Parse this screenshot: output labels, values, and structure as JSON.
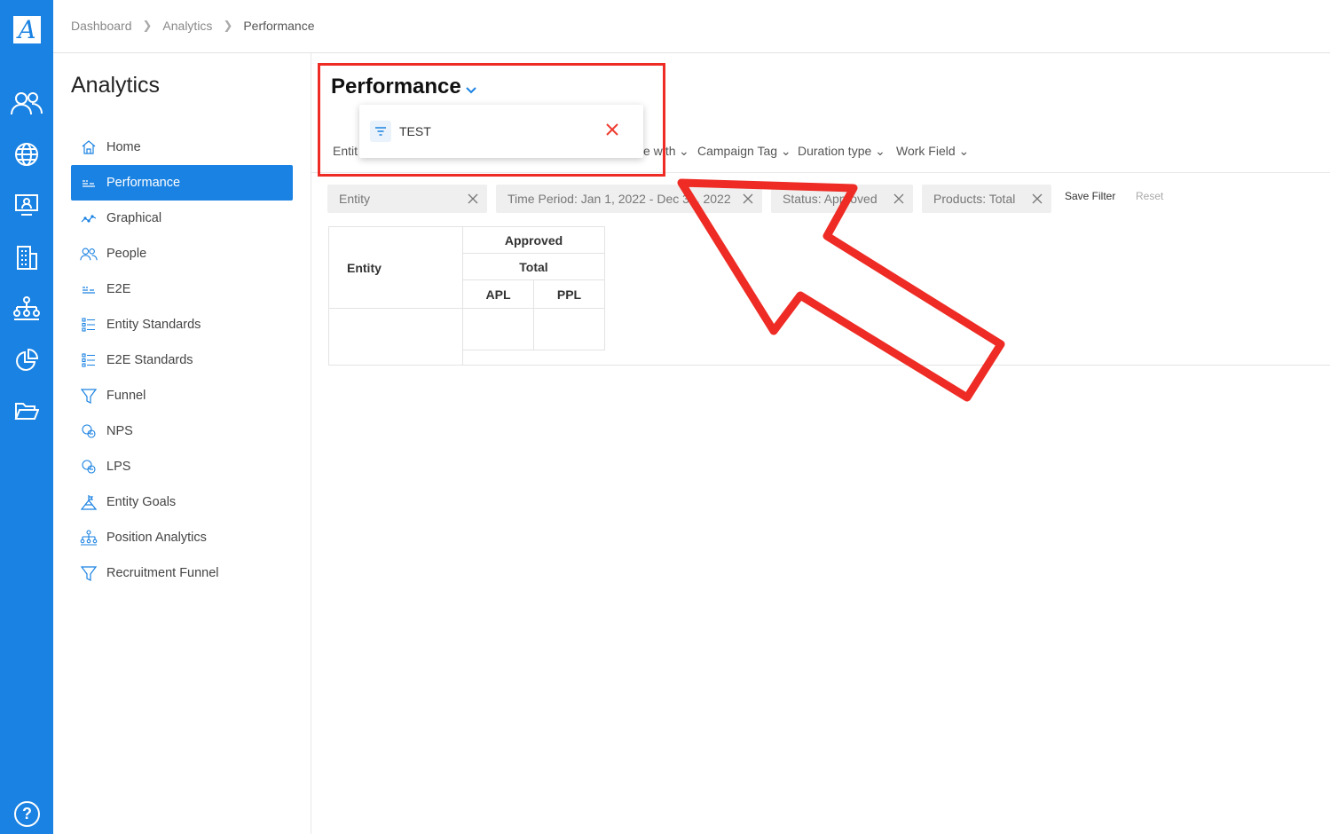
{
  "rail": {
    "logo": "A",
    "icons": [
      "people-icon",
      "globe-icon",
      "monitor-user-icon",
      "building-icon",
      "org-chart-icon",
      "pie-chart-icon",
      "folder-open-icon"
    ],
    "help": "?"
  },
  "breadcrumb": [
    "Dashboard",
    "Analytics",
    "Performance"
  ],
  "sidebar": {
    "title": "Analytics",
    "items": [
      {
        "label": "Home",
        "icon": "home-icon"
      },
      {
        "label": "Performance",
        "icon": "bars-icon",
        "active": true
      },
      {
        "label": "Graphical",
        "icon": "line-graph-icon"
      },
      {
        "label": "People",
        "icon": "people-icon"
      },
      {
        "label": "E2E",
        "icon": "bars-icon"
      },
      {
        "label": "Entity Standards",
        "icon": "list-icon"
      },
      {
        "label": "E2E Standards",
        "icon": "list-icon"
      },
      {
        "label": "Funnel",
        "icon": "funnel-icon"
      },
      {
        "label": "NPS",
        "icon": "nps-icon"
      },
      {
        "label": "LPS",
        "icon": "lps-icon"
      },
      {
        "label": "Entity Goals",
        "icon": "goal-icon"
      },
      {
        "label": "Position Analytics",
        "icon": "org-chart-icon"
      },
      {
        "label": "Recruitment Funnel",
        "icon": "funnel-icon"
      }
    ]
  },
  "main": {
    "title": "Performance",
    "saved_filter": {
      "label": "TEST"
    },
    "filter_bar": {
      "partial_left": "Entit",
      "partial_mid": "e with",
      "items": [
        "Campaign Tag",
        "Duration type",
        "Work Field"
      ]
    },
    "chips": [
      {
        "label": "Entity"
      },
      {
        "label": "Time Period: Jan 1, 2022 - Dec 31, 2022"
      },
      {
        "label": "Status: Approved"
      },
      {
        "label": "Products: Total"
      }
    ],
    "save_filter": "Save Filter",
    "reset": "Reset",
    "table": {
      "row_header": "Entity",
      "group": "Approved",
      "subgroup": "Total",
      "columns": [
        "APL",
        "PPL"
      ]
    }
  },
  "colors": {
    "accent": "#1a82e2",
    "annotation": "#ee2b24"
  }
}
